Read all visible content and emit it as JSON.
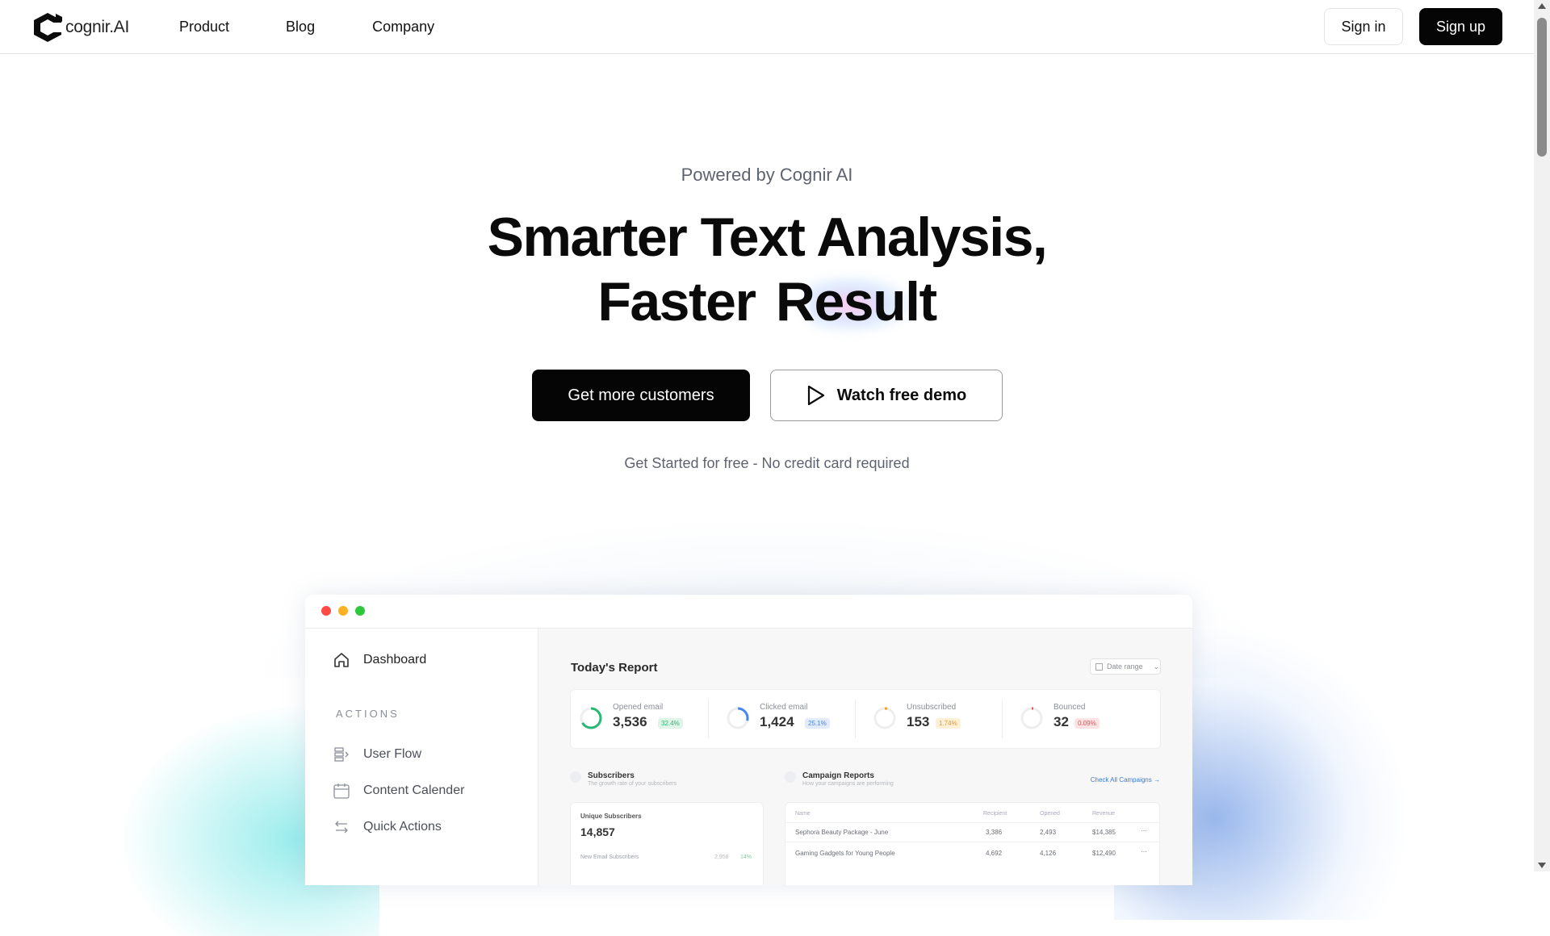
{
  "brand": {
    "name": "cognir.AI"
  },
  "nav": {
    "items": [
      "Product",
      "Blog",
      "Company"
    ]
  },
  "auth": {
    "signin": "Sign in",
    "signup": "Sign up"
  },
  "hero": {
    "powered": "Powered by Cognir AI",
    "line1": "Smarter Text Analysis,",
    "line2a": "Faster",
    "line2b": "Result",
    "cta_primary": "Get more customers",
    "cta_secondary": "Watch free demo",
    "note": "Get Started for free - No credit card required"
  },
  "app": {
    "sidebar": {
      "dashboard": "Dashboard",
      "actions_heading": "ACTIONS",
      "items": [
        "User Flow",
        "Content Calender",
        "Quick Actions"
      ]
    },
    "report": {
      "title": "Today's Report",
      "date_range": "Date range",
      "stats": [
        {
          "label": "Opened email",
          "value": "3,536",
          "pct": "32.4%",
          "color": "#2bb673"
        },
        {
          "label": "Clicked email",
          "value": "1,424",
          "pct": "25.1%",
          "color": "#4a86e8"
        },
        {
          "label": "Unsubscribed",
          "value": "153",
          "pct": "1.74%",
          "color": "#f0a030"
        },
        {
          "label": "Bounced",
          "value": "32",
          "pct": "0.09%",
          "color": "#e85050"
        }
      ]
    },
    "subscribers": {
      "title": "Subscribers",
      "subtitle": "The growth rate of your subscribers",
      "unique_label": "Unique Subscribers",
      "unique_value": "14,857",
      "new_label": "New Email Subscribers",
      "new_value": "2,958",
      "new_pct": "14%"
    },
    "campaigns": {
      "title": "Campaign Reports",
      "subtitle": "How your campaigns are performing",
      "link": "Check All Campaigns",
      "columns": [
        "Name",
        "Recipient",
        "Opened",
        "Revenue"
      ],
      "rows": [
        [
          "Sephora Beauty Package - June",
          "3,386",
          "2,493",
          "$14,385"
        ],
        [
          "Gaming Gadgets for Young People",
          "4,692",
          "4,126",
          "$12,490"
        ]
      ]
    }
  }
}
